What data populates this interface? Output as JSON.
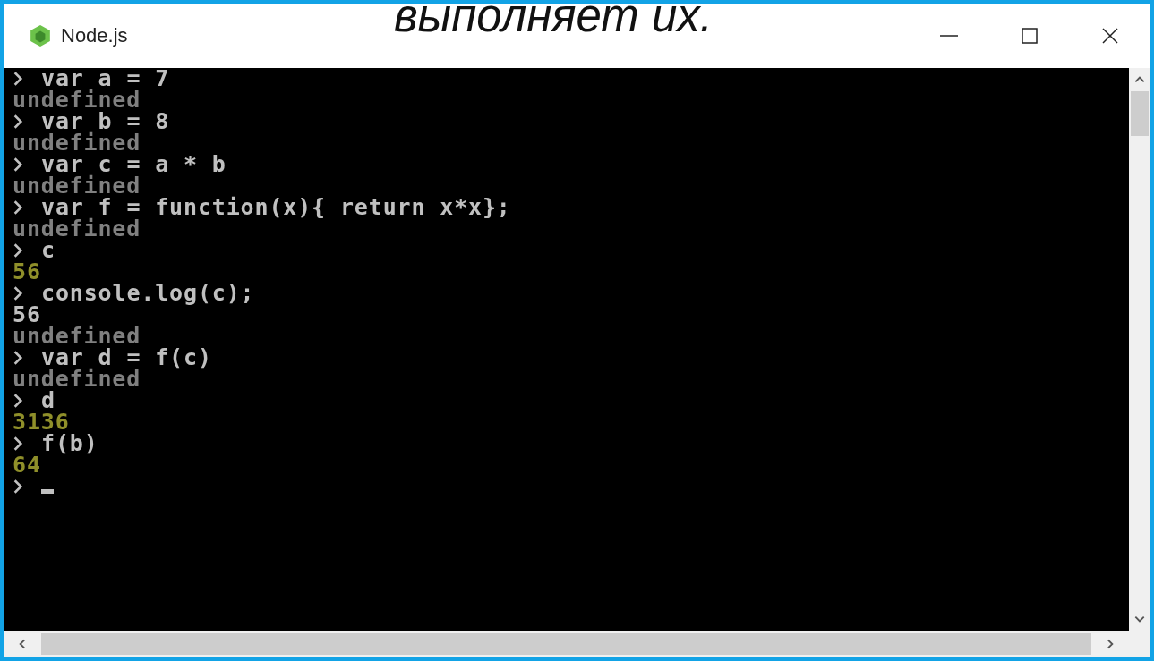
{
  "caption": "выполняет их.",
  "window": {
    "title": "Node.js"
  },
  "console": {
    "lines": [
      {
        "kind": "input",
        "text": "var a = 7"
      },
      {
        "kind": "undefined",
        "text": "undefined"
      },
      {
        "kind": "input",
        "text": "var b = 8"
      },
      {
        "kind": "undefined",
        "text": "undefined"
      },
      {
        "kind": "input",
        "text": "var c = a * b"
      },
      {
        "kind": "undefined",
        "text": "undefined"
      },
      {
        "kind": "input",
        "text": "var f = function(x){ return x*x};"
      },
      {
        "kind": "undefined",
        "text": "undefined"
      },
      {
        "kind": "input",
        "text": "c"
      },
      {
        "kind": "result",
        "text": "56"
      },
      {
        "kind": "input",
        "text": "console.log(c);"
      },
      {
        "kind": "output",
        "text": "56"
      },
      {
        "kind": "undefined",
        "text": "undefined"
      },
      {
        "kind": "input",
        "text": "var d = f(c)"
      },
      {
        "kind": "undefined",
        "text": "undefined"
      },
      {
        "kind": "input",
        "text": "d"
      },
      {
        "kind": "result",
        "text": "3136"
      },
      {
        "kind": "input",
        "text": "f(b)"
      },
      {
        "kind": "result",
        "text": "64"
      },
      {
        "kind": "cursor"
      }
    ]
  }
}
